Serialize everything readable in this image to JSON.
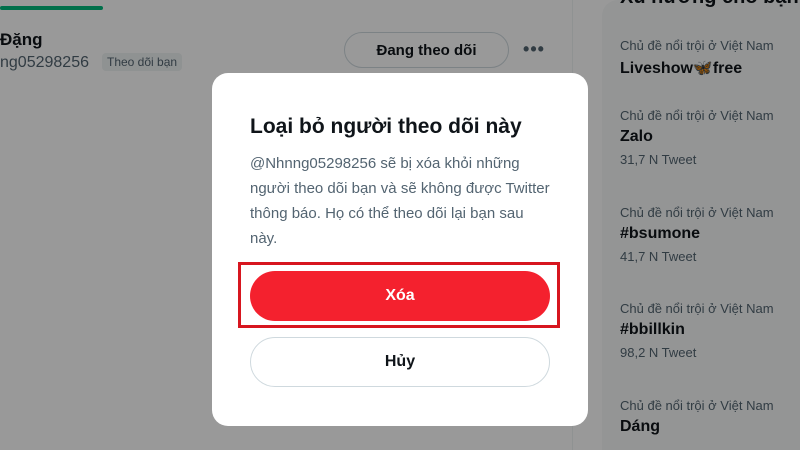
{
  "progress": {
    "fraction": 0.184,
    "color": "#00ba7c"
  },
  "user_row": {
    "name": "Đặng",
    "handle": "ng05298256",
    "follows_you_badge": "Theo dõi bạn",
    "following_button": "Đang theo dõi",
    "more_label": "•••"
  },
  "sidebar": {
    "title": "Xu hướng cho bạn",
    "trends": [
      {
        "context": "Chủ đề nổi trội ở Việt Nam",
        "name": "Liveshow🦋free",
        "count": ""
      },
      {
        "context": "Chủ đề nổi trội ở Việt Nam",
        "name": "Zalo",
        "count": "31,7 N Tweet"
      },
      {
        "context": "Chủ đề nổi trội ở Việt Nam",
        "name": "#bsumone",
        "count": "41,7 N Tweet"
      },
      {
        "context": "Chủ đề nổi trội ở Việt Nam",
        "name": "#bbillkin",
        "count": "98,2 N Tweet"
      },
      {
        "context": "Chủ đề nổi trội ở Việt Nam",
        "name": "Dáng",
        "count": ""
      }
    ]
  },
  "dialog": {
    "title": "Loại bỏ người theo dõi này",
    "body": "@Nhnng05298256 sẽ bị xóa khỏi những người theo dõi bạn và sẽ không được Twitter thông báo. Họ có thể theo dõi lại bạn sau này.",
    "confirm_label": "Xóa",
    "cancel_label": "Hủy"
  },
  "colors": {
    "accent_danger": "#f4212e",
    "highlight_box": "#d7161f",
    "secondary_text": "#536471"
  }
}
